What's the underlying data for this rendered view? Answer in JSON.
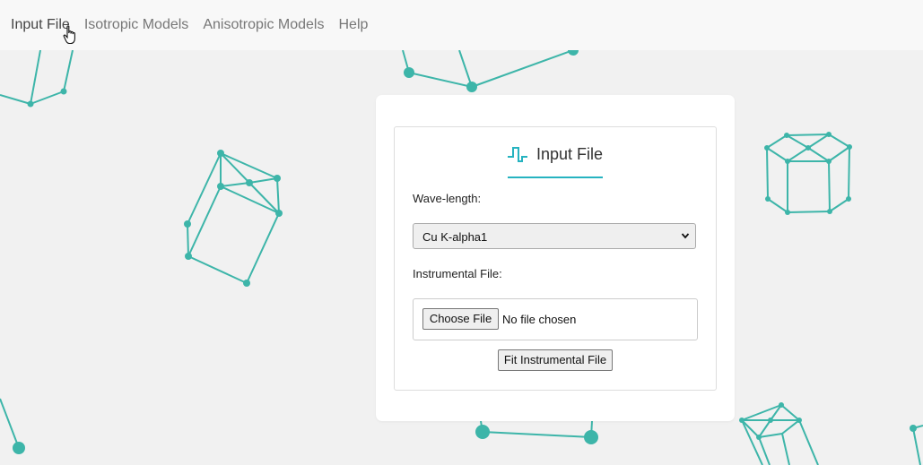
{
  "nav": {
    "items": [
      {
        "label": "Input File",
        "active": true
      },
      {
        "label": "Isotropic Models",
        "active": false
      },
      {
        "label": "Anisotropic Models",
        "active": false
      },
      {
        "label": "Help",
        "active": false
      }
    ]
  },
  "card": {
    "title": "Input File",
    "title_icon": "pulse-wave-icon",
    "wavelength_label": "Wave-length:",
    "wavelength_selected": "Cu K-alpha1",
    "instrumental_label": "Instrumental File:",
    "choose_button": "Choose File",
    "no_file_text": "No file chosen",
    "fit_button": "Fit Instrumental File"
  },
  "colors": {
    "accent": "#26b3c0",
    "molecule": "#3db5a9",
    "page_bg": "#f1f1f1",
    "navbar_bg": "#f8f8f8"
  }
}
